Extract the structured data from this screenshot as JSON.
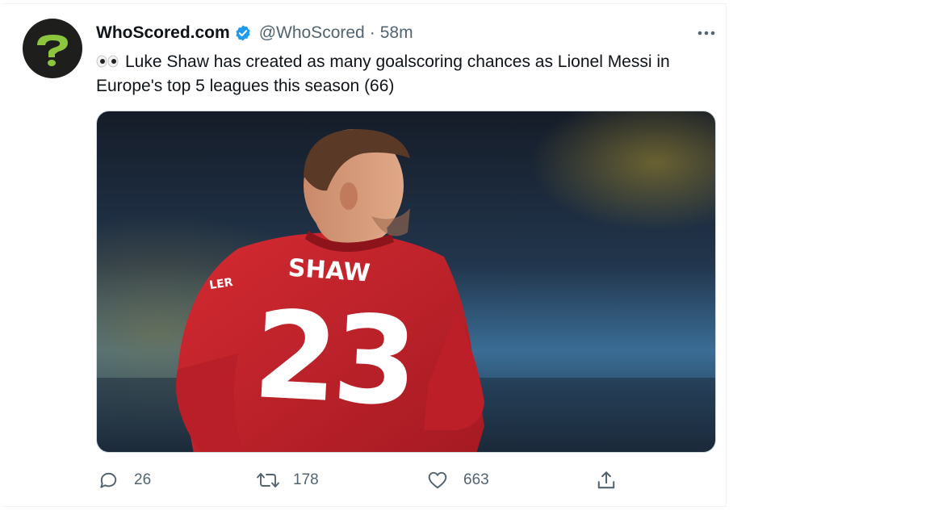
{
  "tweet": {
    "display_name": "WhoScored.com",
    "handle": "@WhoScored",
    "separator": "·",
    "time": "58m",
    "text": "Luke Shaw has created as many goalscoring chances as Lionel Messi in Europe's top 5 leagues this season (66)",
    "emoji_icon": "eyes-emoji-icon",
    "media": {
      "jersey_name": "SHAW",
      "jersey_number": "23",
      "sleeve_text": "LER",
      "description_colors": {
        "jersey": "#c8202a",
        "background_blue": "#2c5b80"
      }
    },
    "stats": {
      "replies": "26",
      "retweets": "178",
      "likes": "663"
    }
  },
  "colors": {
    "verified": "#1d9bf0",
    "secondary_text": "#536471",
    "avatar_bg": "#1e1f1c",
    "avatar_mark": "#8cc63f"
  }
}
